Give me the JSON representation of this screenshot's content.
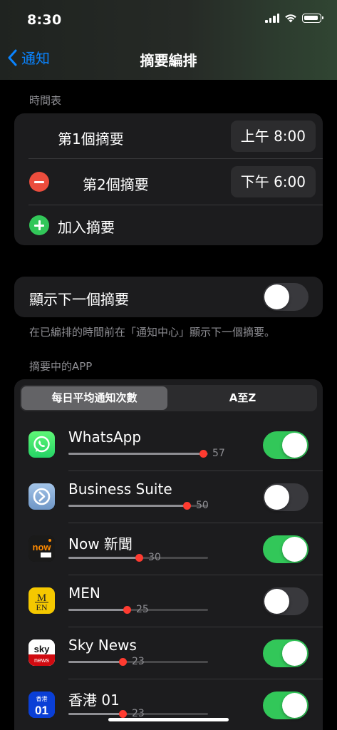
{
  "status_bar": {
    "time": "8:30"
  },
  "nav": {
    "back_label": "通知",
    "title": "摘要編排"
  },
  "schedule": {
    "header": "時間表",
    "items": [
      {
        "label": "第1個摘要",
        "time": "上午 8:00"
      },
      {
        "label": "第2個摘要",
        "time": "下午 6:00"
      }
    ],
    "add_label": "加入摘要"
  },
  "next_summary": {
    "label": "顯示下一個摘要",
    "enabled": false,
    "footer": "在已編排的時間前在「通知中心」顯示下一個摘要。"
  },
  "apps_section": {
    "header": "摘要中的APP",
    "segments": [
      "每日平均通知次數",
      "A至Z"
    ],
    "selected_segment": "每日平均通知次數",
    "apps": [
      {
        "name": "WhatsApp",
        "count": "57",
        "enabled": true,
        "icon": "whatsapp-icon"
      },
      {
        "name": "Business Suite",
        "count": "50",
        "enabled": false,
        "icon": "business-suite-icon"
      },
      {
        "name": "Now 新聞",
        "count": "30",
        "enabled": true,
        "icon": "now-news-icon"
      },
      {
        "name": "MEN",
        "count": "25",
        "enabled": false,
        "icon": "men-icon"
      },
      {
        "name": "Sky News",
        "count": "23",
        "enabled": true,
        "icon": "sky-news-icon"
      },
      {
        "name": "香港 01",
        "count": "23",
        "enabled": true,
        "icon": "hk01-icon"
      }
    ]
  },
  "colors": {
    "accent": "#0a84ff",
    "toggle_on": "#32c759",
    "slider_dot": "#ff3b30"
  }
}
